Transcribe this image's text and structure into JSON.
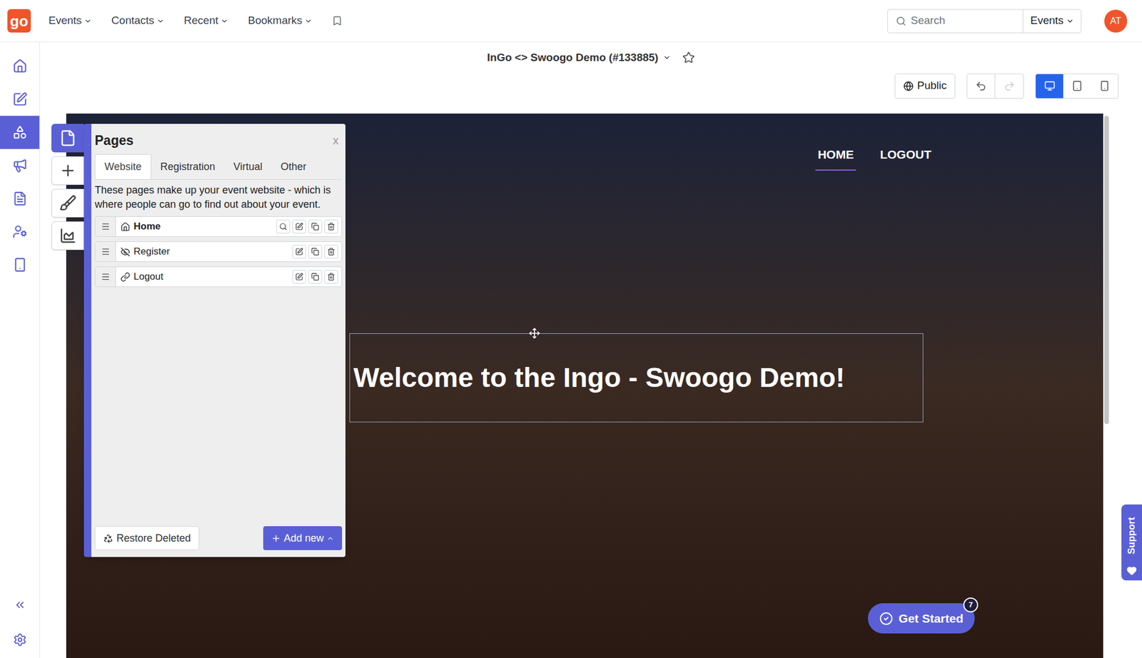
{
  "logo": "go",
  "nav": [
    {
      "label": "Events"
    },
    {
      "label": "Contacts"
    },
    {
      "label": "Recent"
    },
    {
      "label": "Bookmarks"
    }
  ],
  "search": {
    "placeholder": "Search",
    "scope": "Events"
  },
  "avatar": "AT",
  "sidebar": {
    "items": [
      {
        "selected": false
      },
      {
        "selected": false
      },
      {
        "selected": true
      },
      {
        "selected": false
      },
      {
        "selected": false
      },
      {
        "selected": false
      },
      {
        "selected": false
      }
    ]
  },
  "event_title": "InGo <> Swoogo Demo (#133885)",
  "toolbar": {
    "visibility": "Public",
    "undo_disabled": false,
    "redo_disabled": true,
    "devices": [
      {
        "selected": true
      },
      {
        "selected": false
      },
      {
        "selected": false
      }
    ]
  },
  "pages_panel": {
    "title": "Pages",
    "close": "x",
    "tools": [
      {
        "selected": true
      },
      {
        "selected": false
      },
      {
        "selected": false
      },
      {
        "selected": false
      }
    ],
    "tabs": [
      {
        "label": "Website",
        "selected": true
      },
      {
        "label": "Registration",
        "selected": false
      },
      {
        "label": "Virtual",
        "selected": false
      },
      {
        "label": "Other",
        "selected": false
      }
    ],
    "description": "These pages make up your event website - which is where people can go to find out about your event.",
    "pages": [
      {
        "name": "Home",
        "kind": "home"
      },
      {
        "name": "Register",
        "kind": "hidden"
      },
      {
        "name": "Logout",
        "kind": "link"
      }
    ],
    "restore_button": "Restore Deleted",
    "add_button": "Add new"
  },
  "site": {
    "nav": [
      {
        "label": "HOME",
        "selected": true
      },
      {
        "label": "LOGOUT",
        "selected": false
      }
    ],
    "heading": "Welcome to the Ingo - Swoogo Demo!"
  },
  "get_started": {
    "label": "Get Started",
    "badge": "7"
  },
  "support": "Support"
}
